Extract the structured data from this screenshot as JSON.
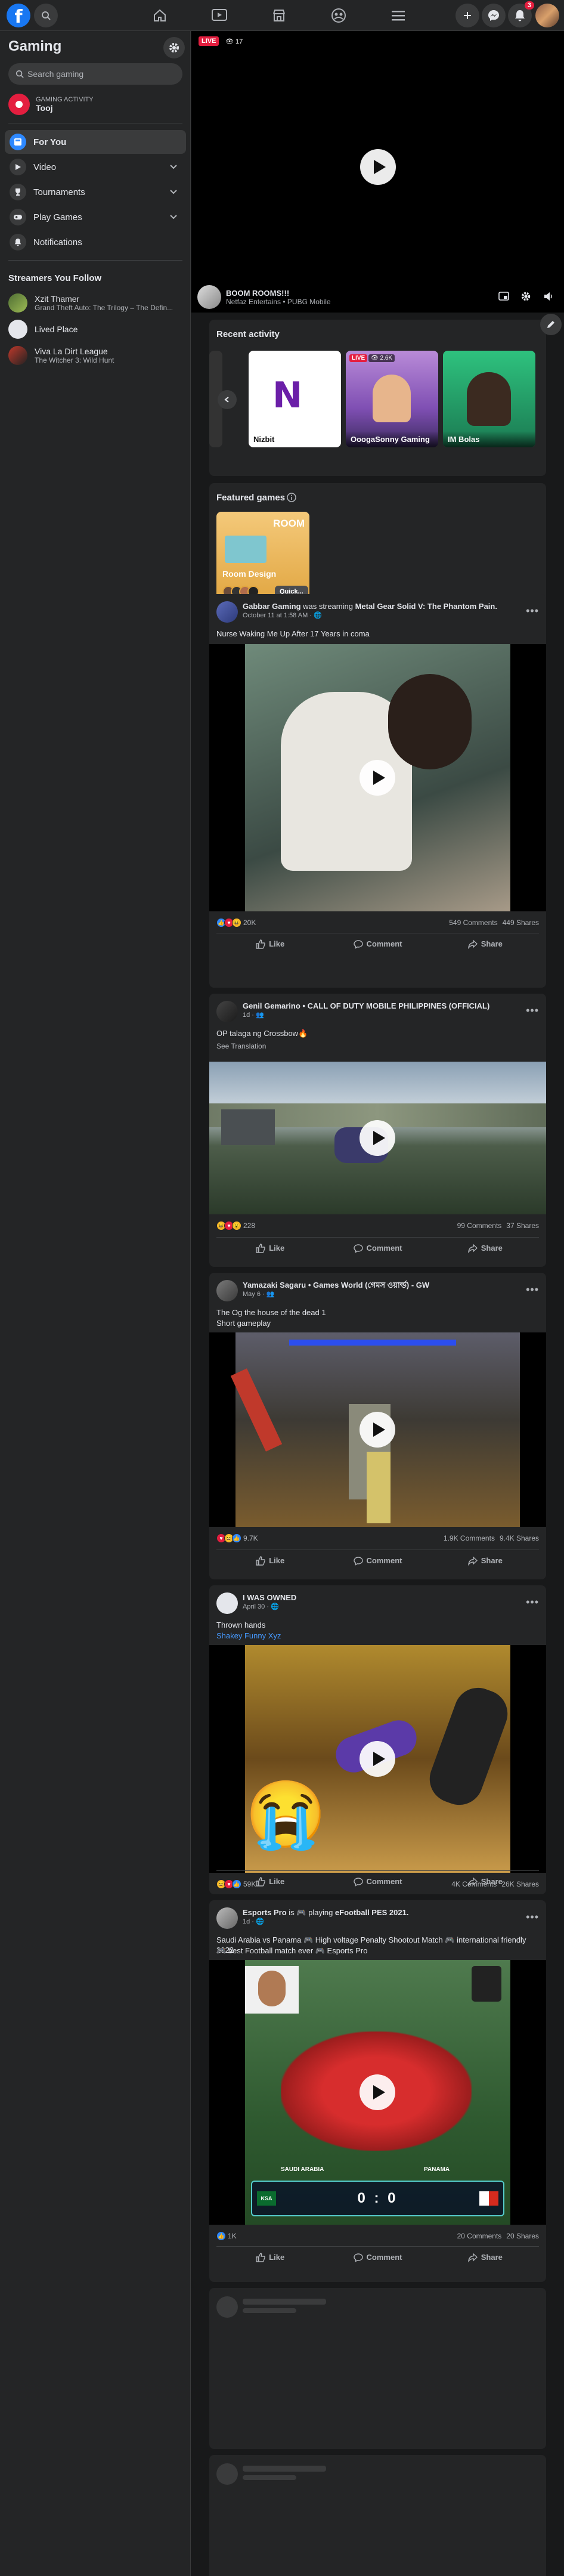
{
  "topbar": {
    "logo": "f",
    "notif_badge": "3",
    "nav_icons": [
      "home-icon",
      "watch-icon",
      "marketplace-icon",
      "groups-icon",
      "gaming-icon",
      "menu-icon"
    ]
  },
  "sidebar": {
    "title": "Gaming",
    "search_placeholder": "Search gaming",
    "activity_small": "GAMING ACTIVITY",
    "activity_name": "Tooj",
    "items": [
      {
        "label": "For You"
      },
      {
        "label": "Video"
      },
      {
        "label": "Tournaments"
      },
      {
        "label": "Play Games"
      },
      {
        "label": "Notifications"
      }
    ],
    "streamers_title": "Streamers You Follow",
    "streamers": [
      {
        "name": "Xzit Thamer",
        "sub": "Grand Theft Auto: The Trilogy – The Defin..."
      },
      {
        "name": "Lived Place",
        "sub": ""
      },
      {
        "name": "Viva La Dirt League",
        "sub": "The Witcher 3: Wild Hunt"
      }
    ]
  },
  "player": {
    "live": "LIVE",
    "viewers": "17",
    "channel": "BOOM ROOMS!!!",
    "subtitle": "Netfaz Entertains • PUBG Mobile"
  },
  "recent": {
    "title": "Recent activity",
    "tiles": [
      {
        "label": "Nizbit",
        "letter": "N"
      },
      {
        "label": "OoogaSonny Gaming",
        "live": "LIVE",
        "views": "2.6K"
      },
      {
        "label": "IM Bolas"
      }
    ]
  },
  "featured": {
    "title": "Featured games",
    "game": "Room Design",
    "logo_text": "ROOM",
    "button": "Quick..."
  },
  "posts": [
    {
      "name": "Gabbar Gaming",
      "action": " was streaming ",
      "game": "Metal Gear Solid V: The Phantom Pain.",
      "time": "October 11 at 1:58 AM · 🌐",
      "text": "Nurse Waking Me Up After 17 Years in coma",
      "text2": "",
      "reactions": "20K",
      "comments": "549 Comments",
      "shares": "449 Shares"
    },
    {
      "name": "Genil Gemarino • CALL OF DUTY MOBILE PHILIPPINES (OFFICIAL)",
      "action": "",
      "game": "",
      "time": "1d · 👥",
      "text": "OP talaga ng Crossbow🔥",
      "text2": "See Translation",
      "reactions": "228",
      "comments": "99 Comments",
      "shares": "37 Shares"
    },
    {
      "name": "Yamazaki Sagaru • Games World (গেমস ওয়ার্ল্ড) - GW",
      "action": "",
      "game": "",
      "time": "May 6 · 👥",
      "text": "The Og the house of the dead 1",
      "text2": "Short gameplay",
      "reactions": "9.7K",
      "comments": "1.9K Comments",
      "shares": "9.4K Shares"
    },
    {
      "name": "I WAS OWNED",
      "action": "",
      "game": "",
      "time": "April 30 · 🌐",
      "text": "Thrown hands",
      "text2": "Shakey Funny Xyz",
      "reactions": "59K",
      "comments": "4K Comments",
      "shares": "26K Shares"
    },
    {
      "name": "Esports Pro",
      "action": " is 🎮 playing ",
      "game": "eFootball PES 2021.",
      "time": "1d · 🌐",
      "text": "Saudi Arabia vs Panama 🎮 High voltage Penalty Shootout Match 🎮 international friendly 2022",
      "text2": "🎮 best Football match ever 🎮 Esports Pro",
      "reactions": "1K",
      "comments": "20 Comments",
      "shares": "20 Shares",
      "score_left": "SAUDI ARABIA",
      "score_right": "PANAMA",
      "score": "0 : 0",
      "team_left_abbr": "KSA"
    }
  ],
  "actions": {
    "like": "Like",
    "comment": "Comment",
    "share": "Share"
  }
}
